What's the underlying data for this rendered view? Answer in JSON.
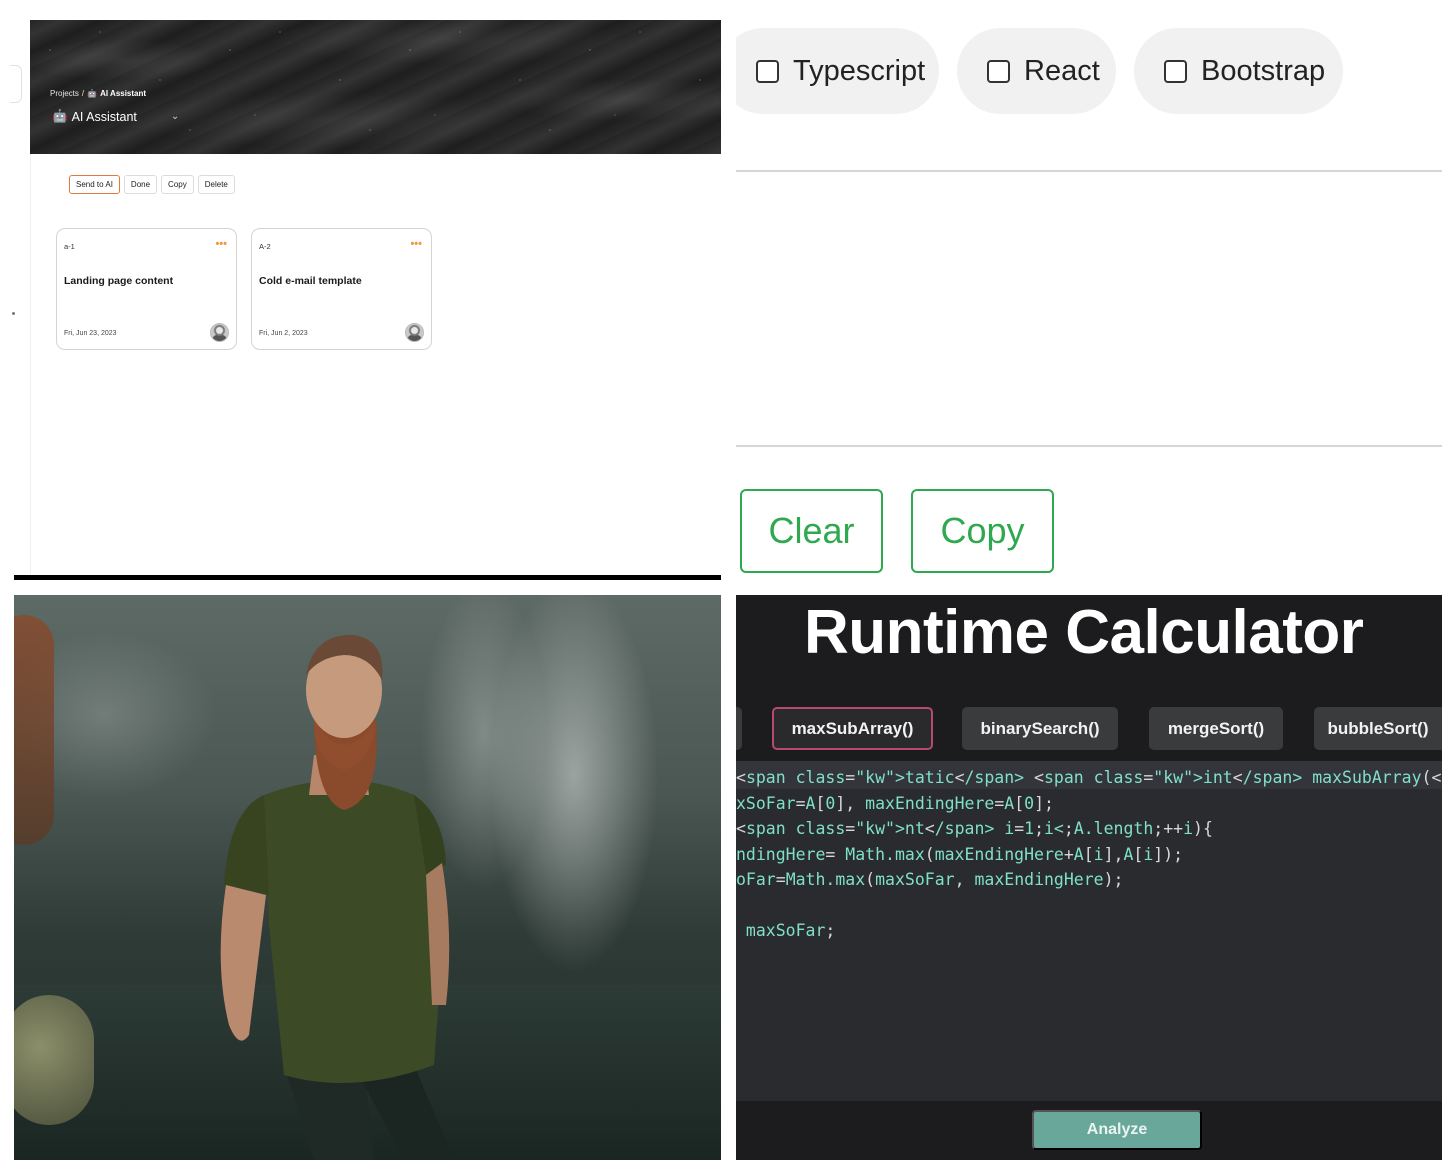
{
  "board": {
    "breadcrumb": {
      "root": "Projects",
      "separator": "/",
      "current": "AI Assistant",
      "current_icon": "robot-icon"
    },
    "project_title": "AI Assistant",
    "project_icon": "robot-icon",
    "toolbar": {
      "send_to_ai": "Send to AI",
      "done": "Done",
      "copy": "Copy",
      "delete": "Delete",
      "accent": "#e07a3f"
    },
    "cards": [
      {
        "id": "a-1",
        "title": "Landing page content",
        "date": "Fri, Jun 23, 2023"
      },
      {
        "id": "A-2",
        "title": "Cold e-mail template",
        "date": "Fri, Jun 2, 2023"
      }
    ],
    "menu_dots": "•••",
    "dots_color": "#ef9a3a"
  },
  "tags": {
    "options": [
      {
        "label": "Typescript",
        "checked": false
      },
      {
        "label": "React",
        "checked": false
      },
      {
        "label": "Bootstrap",
        "checked": false
      }
    ],
    "clear_label": "Clear",
    "copy_label": "Copy",
    "button_color": "#2fa84f"
  },
  "calculator": {
    "title": "Runtime Calculator",
    "tabs": [
      "maxSubArray()",
      "binarySearch()",
      "mergeSort()",
      "bubbleSort()"
    ],
    "active_tab": "maxSubArray()",
    "code_lines": [
      "tatic int maxSubArray(int[] A) {",
      "xSoFar=A[0], maxEndingHere=A[0];",
      "nt i=1;i<A.length;++i){",
      "ndingHere= Math.max(maxEndingHere+A[i],A[i]);",
      "oFar=Math.max(maxSoFar, maxEndingHere);",
      "",
      " maxSoFar;"
    ],
    "analyze_label": "Analyze",
    "accent_tab_border": "#b54a6a",
    "analyze_color": "#6aa79b"
  }
}
